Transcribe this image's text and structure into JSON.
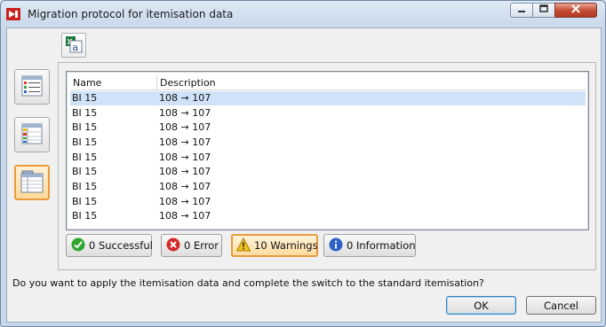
{
  "window": {
    "title": "Migration protocol for itemisation data"
  },
  "toolbar": {
    "export_icon": "excel-export-icon"
  },
  "sidebar": {
    "items": [
      {
        "icon": "list-view-icon",
        "active": false
      },
      {
        "icon": "table-colored-view-icon",
        "active": false
      },
      {
        "icon": "table-detail-view-icon",
        "active": true
      }
    ]
  },
  "table": {
    "columns": [
      "Name",
      "Description"
    ],
    "rows": [
      [
        "BI 15",
        "108 → 107"
      ],
      [
        "BI 15",
        "108 → 107"
      ],
      [
        "BI 15",
        "108 → 107"
      ],
      [
        "BI 15",
        "108 → 107"
      ],
      [
        "BI 15",
        "108 → 107"
      ],
      [
        "BI 15",
        "108 → 107"
      ],
      [
        "BI 15",
        "108 → 107"
      ],
      [
        "BI 15",
        "108 → 107"
      ],
      [
        "BI 15",
        "108 → 107"
      ]
    ]
  },
  "status": {
    "successful": "0 Successful",
    "error": "0 Error",
    "warnings": "10 Warnings",
    "information": "0 Information"
  },
  "footer": {
    "question": "Do you want to apply the itemisation data and complete the switch to the standard itemisation?",
    "ok": "OK",
    "cancel": "Cancel"
  },
  "colors": {
    "accent": "#e79b3e",
    "selection": "#cfe2f7",
    "success": "#2fa62f",
    "error": "#d42a2a",
    "warning": "#f2c31a",
    "info": "#2d62c4"
  }
}
